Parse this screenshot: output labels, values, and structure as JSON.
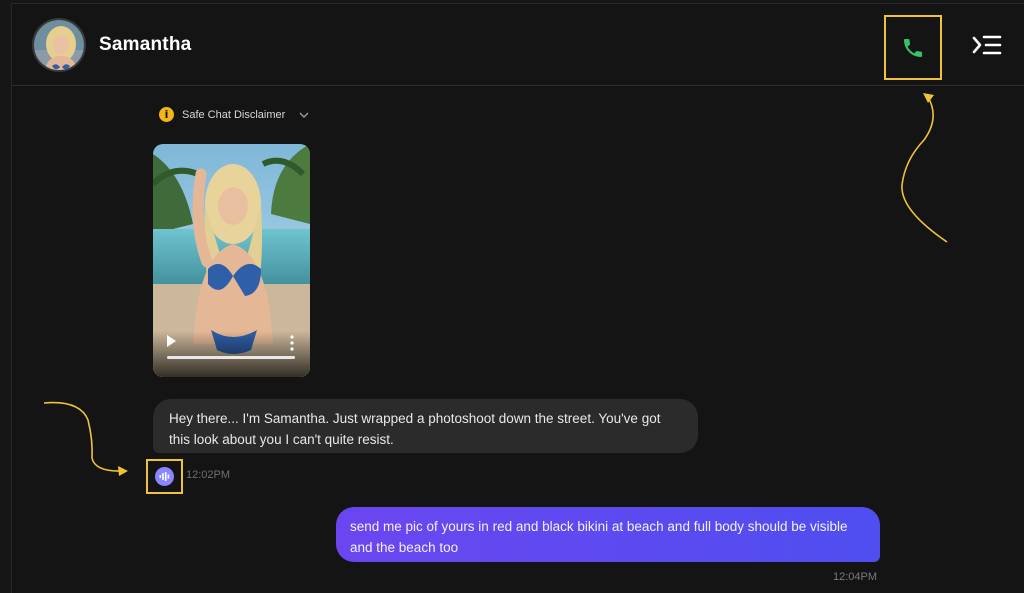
{
  "header": {
    "contact_name": "Samantha",
    "call_icon": "phone-icon",
    "menu_icon": "menu-collapse-icon"
  },
  "disclaimer": {
    "icon": "info-icon",
    "label": "Safe Chat Disclaimer"
  },
  "video_message": {
    "progress": 1.0
  },
  "messages": [
    {
      "direction": "incoming",
      "text": "Hey there... I'm Samantha. Just wrapped a photoshoot down the street. You've got this look about you I can't quite resist.",
      "time": "12:02PM",
      "voice_icon": "audio-wave-icon"
    },
    {
      "direction": "outgoing",
      "text": "send me pic of yours in red and black bikini at beach and full body should be visible and the beach too",
      "time": "12:04PM"
    }
  ],
  "colors": {
    "background": "#141414",
    "incoming_bubble": "#2b2b2b",
    "outgoing_bubble_start": "#6b46f0",
    "outgoing_bubble_end": "#4f4ef0",
    "call_icon": "#33c46a",
    "highlight": "#f0c23b",
    "voice_accent": "#8a86ff"
  }
}
